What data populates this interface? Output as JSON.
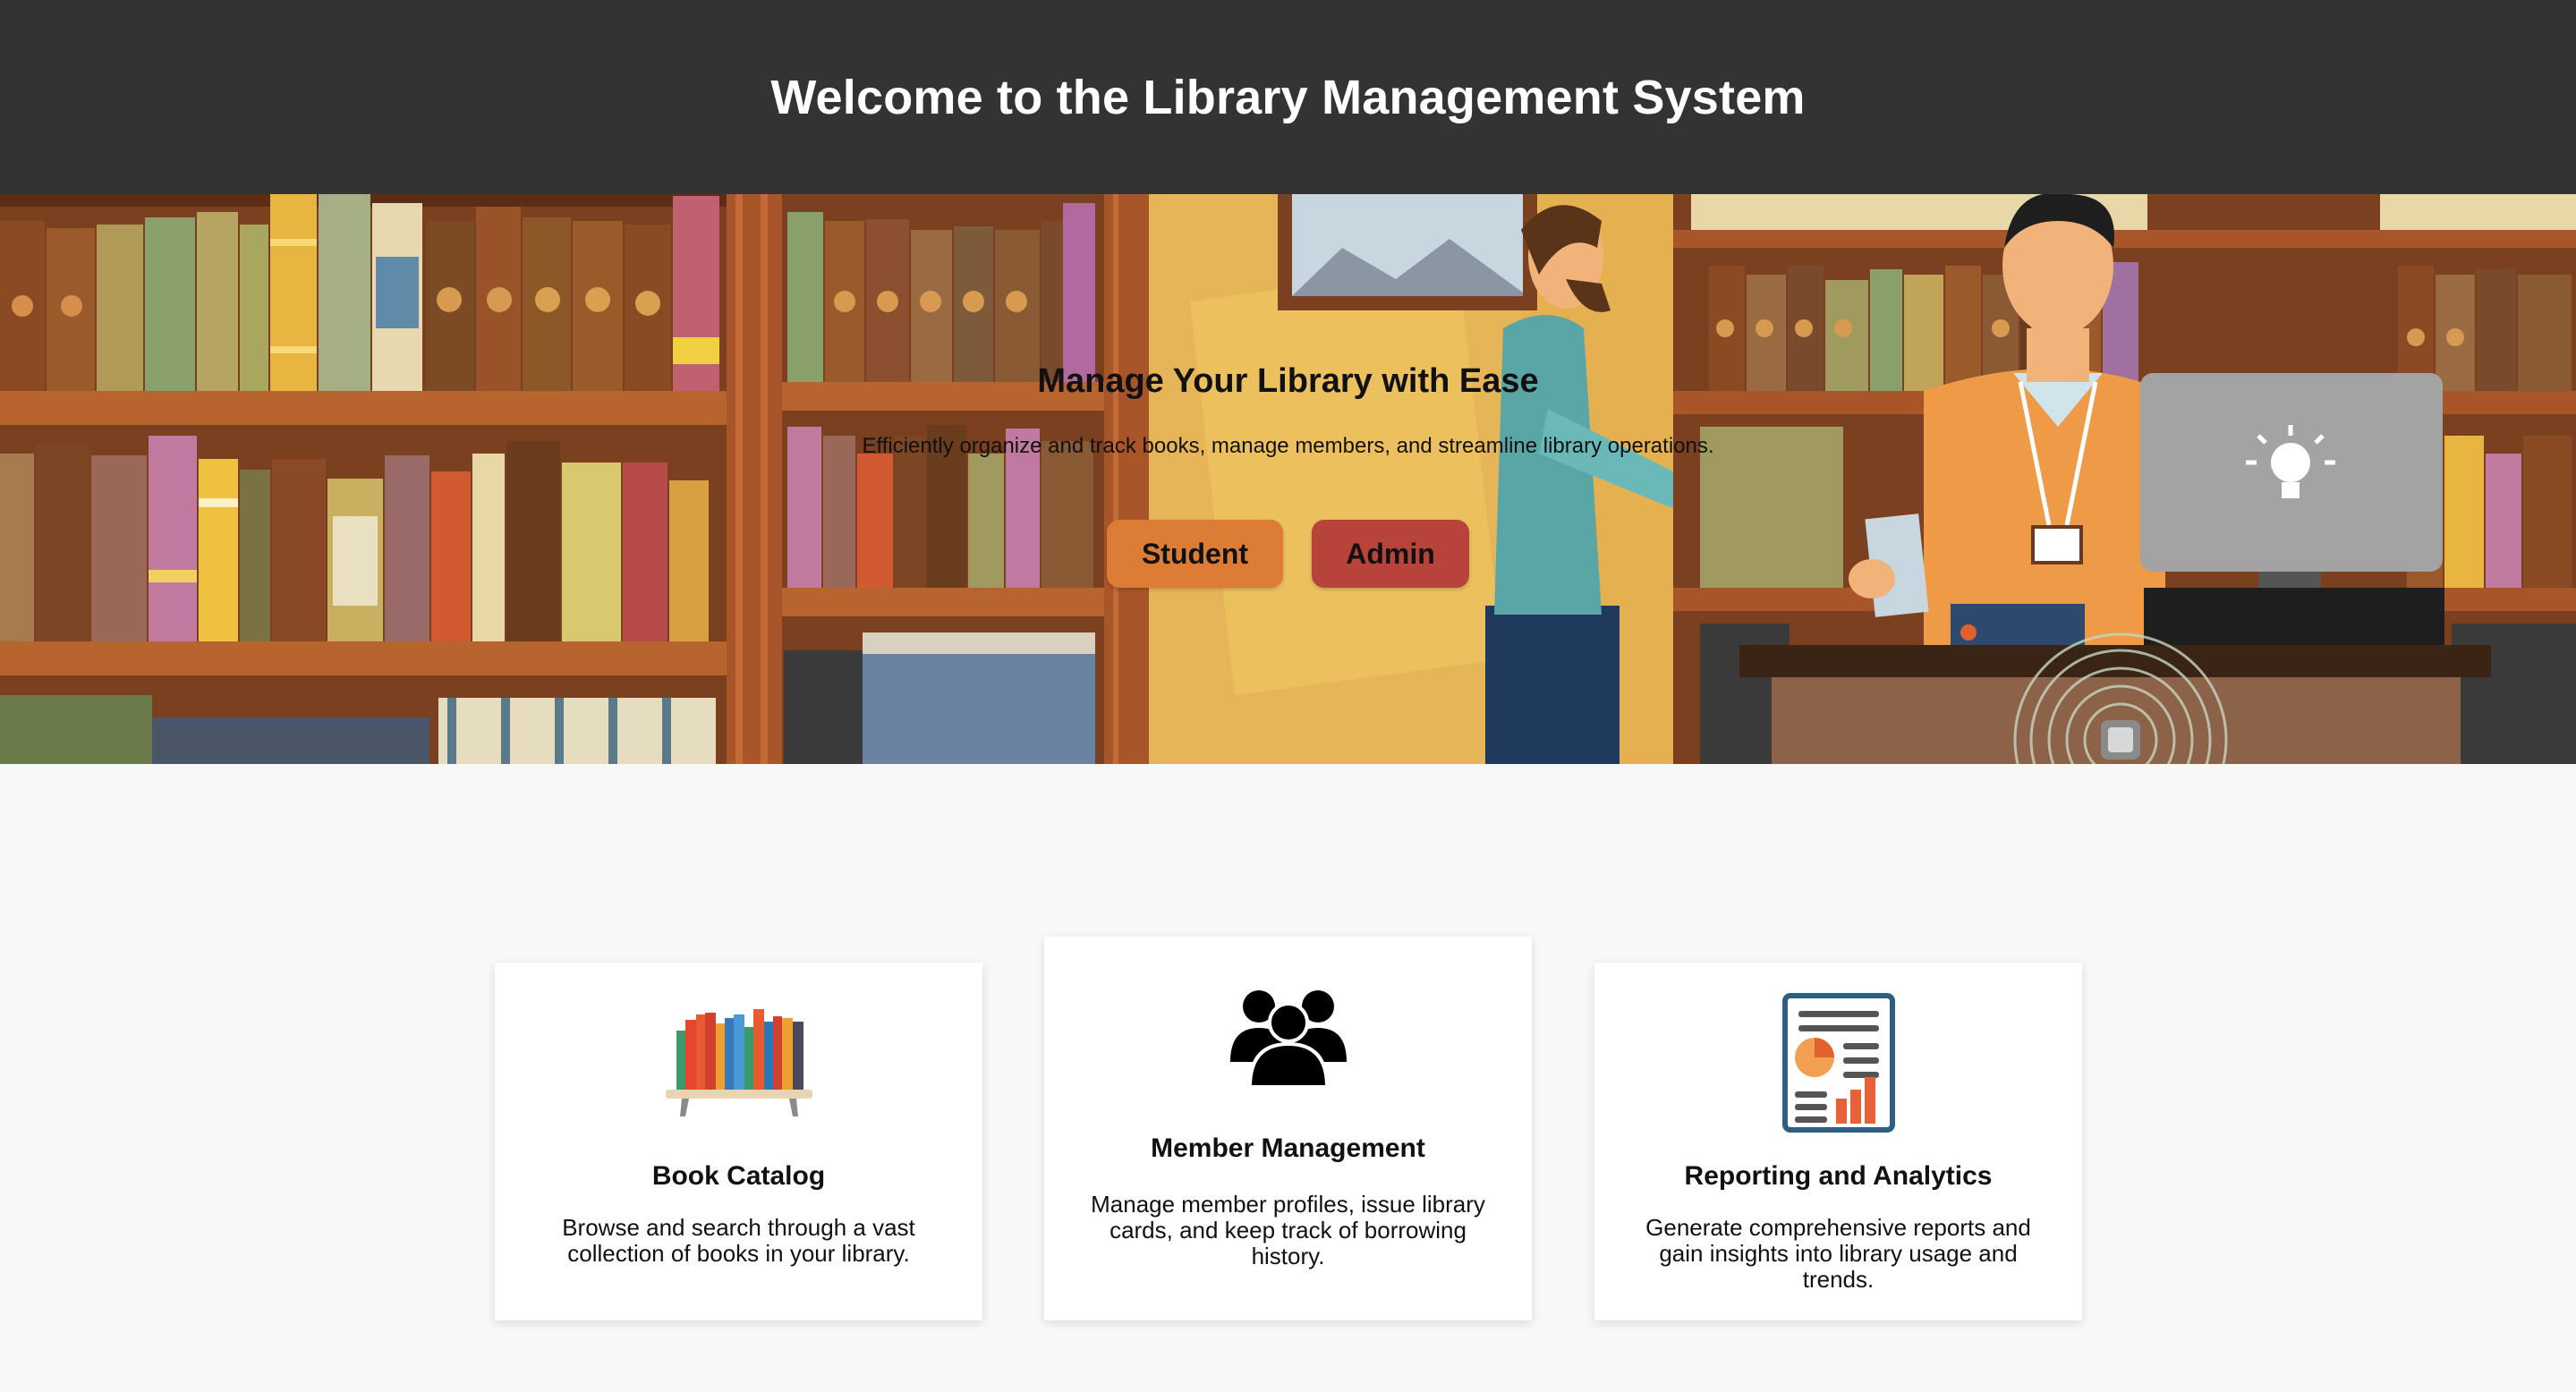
{
  "header": {
    "title": "Welcome to the Library Management System"
  },
  "hero": {
    "title": "Manage Your Library with Ease",
    "subtitle": "Efficiently organize and track books, manage members, and streamline library operations.",
    "buttons": {
      "student_label": "Student",
      "admin_label": "Admin"
    },
    "background_image": "library-illustration",
    "colors": {
      "student_button": "#dd7d35",
      "admin_button": "#b8433a"
    }
  },
  "features": [
    {
      "icon": "bookshelf-icon",
      "title": "Book Catalog",
      "description": "Browse and search through a vast collection of books in your library."
    },
    {
      "icon": "users-group-icon",
      "title": "Member Management",
      "description": "Manage member profiles, issue library cards, and keep track of borrowing history."
    },
    {
      "icon": "report-chart-icon",
      "title": "Reporting and Analytics",
      "description": "Generate comprehensive reports and gain insights into library usage and trends."
    }
  ],
  "colors": {
    "header_bg": "#333333",
    "page_bg": "#f8f8f8"
  }
}
